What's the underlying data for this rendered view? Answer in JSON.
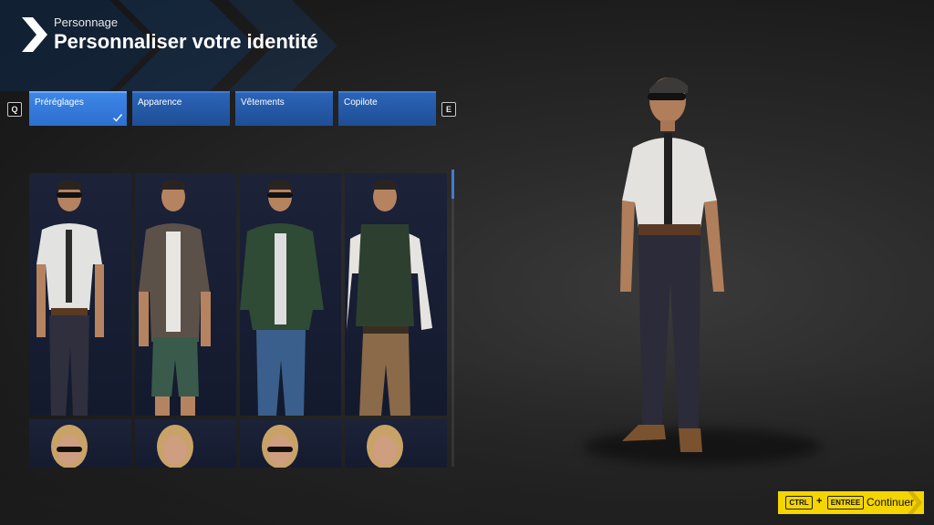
{
  "header": {
    "subtitle": "Personnage",
    "title": "Personnaliser votre identité"
  },
  "tabs": {
    "prev_key": "Q",
    "next_key": "E",
    "items": [
      {
        "label": "Préréglages",
        "active": true
      },
      {
        "label": "Apparence",
        "active": false
      },
      {
        "label": "Vêtements",
        "active": false
      },
      {
        "label": "Copilote",
        "active": false
      }
    ]
  },
  "presets": {
    "row1": [
      "pilot-uniform-preset",
      "casual-shirt-shorts-preset",
      "green-bomber-jacket-preset",
      "green-vest-preset"
    ],
    "row2": [
      "female-sunglasses-preset",
      "female-preset",
      "female-sunglasses-preset-2",
      "female-preset-2"
    ]
  },
  "footer": {
    "key1": "CTRL",
    "plus": "+",
    "key2": "ENTREE",
    "continue_label": "Continuer"
  },
  "colors": {
    "accent_blue": "#2c6fd0",
    "continue_yellow": "#f5d500"
  }
}
